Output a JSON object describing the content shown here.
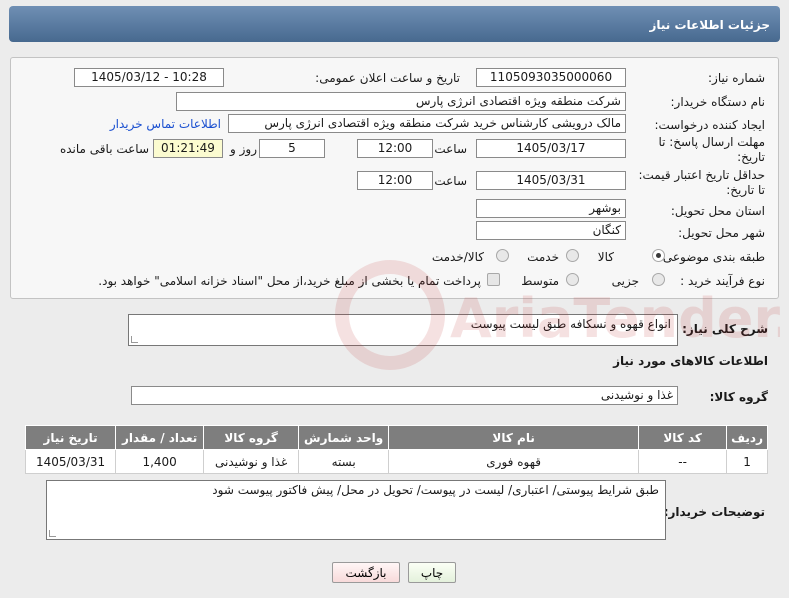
{
  "header": {
    "title": "جزئیات اطلاعات نیاز"
  },
  "fields": {
    "need_number_label": "شماره نیاز:",
    "need_number": "1105093035000060",
    "announce_label": "تاریخ و ساعت اعلان عمومی:",
    "announce_value": "1405/03/12 - 10:28",
    "buyer_org_label": "نام دستگاه خریدار:",
    "buyer_org": "شرکت منطقه ویژه اقتصادی انرژی پارس",
    "requester_label": "ایجاد کننده درخواست:",
    "requester": "مالک  درویشی کارشناس خرید شرکت منطقه ویژه اقتصادی انرژی پارس",
    "contact_link": "اطلاعات تماس خریدار",
    "deadline_label_1": "مهلت ارسال پاسخ: تا",
    "deadline_label_2": "تاریخ:",
    "deadline_date": "1405/03/17",
    "time_label": "ساعت",
    "deadline_time": "12:00",
    "days_value": "5",
    "days_label": "روز و",
    "remaining_value": "01:21:49",
    "remaining_label": "ساعت باقی مانده",
    "validity_label_1": "حداقل تاریخ اعتبار قیمت:",
    "validity_label_2": "تا تاریخ:",
    "validity_date": "1405/03/31",
    "validity_time": "12:00",
    "province_label": "استان محل تحویل:",
    "province": "بوشهر",
    "city_label": "شهر محل تحویل:",
    "city": "کنگان",
    "category_label": "طبقه بندی موضوعی:",
    "category_options": [
      "کالا",
      "خدمت",
      "کالا/خدمت"
    ],
    "process_label": "نوع فرآیند خرید :",
    "process_options": [
      "جزیی",
      "متوسط"
    ],
    "treasury_note": "پرداخت تمام یا بخشی از مبلغ خرید،از محل \"اسناد خزانه اسلامی\" خواهد بود."
  },
  "summary": {
    "label": "شرح کلی نیاز:",
    "value": "انواع قهوه و نسکافه طبق لیست پیوست"
  },
  "goods": {
    "section_title": "اطلاعات کالاهای مورد نیاز",
    "group_label": "گروه کالا:",
    "group_value": "غذا و نوشیدنی",
    "columns": [
      "ردیف",
      "کد کالا",
      "نام کالا",
      "واحد شمارش",
      "گروه کالا",
      "تعداد / مقدار",
      "تاریخ نیاز"
    ],
    "rows": [
      [
        "1",
        "--",
        "قهوه فوری",
        "بسته",
        "غذا و نوشیدنی",
        "1,400",
        "1405/03/31"
      ]
    ]
  },
  "buyer_notes": {
    "label": "توضیحات خریدار:",
    "value": "طبق شرایط پیوستی/ اعتباری/ لیست در پیوست/ تحویل در محل/ پیش فاکتور پیوست شود"
  },
  "buttons": {
    "print": "چاپ",
    "back": "بازگشت"
  },
  "watermark": {
    "text": "AriaTender.net"
  },
  "colors": {
    "header": "#567aa3",
    "link": "#1a4fd0",
    "table_header": "#7e7e7e"
  }
}
